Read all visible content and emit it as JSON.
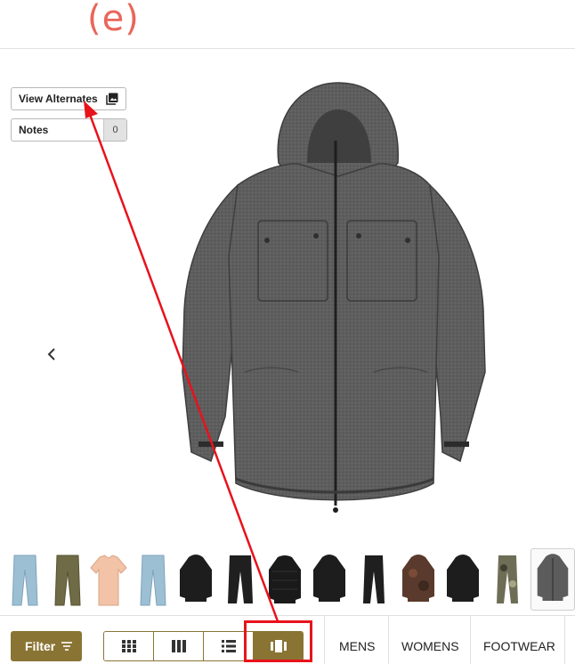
{
  "header": {
    "logo_text": "(e)",
    "logo_color": "#e9665a"
  },
  "controls": {
    "view_alternates_label": "View Alternates",
    "view_alternates_icon": "image-gallery-icon",
    "notes_label": "Notes",
    "notes_count": "0",
    "prev_icon": "chevron-left-icon"
  },
  "product": {
    "image": "charcoal-heather-hooded-snow-jacket"
  },
  "thumbnails": [
    "light-wash-jeans",
    "olive-pants",
    "peach-tshirt",
    "light-wash-jeans-2",
    "black-hooded-jacket",
    "black-snow-pants",
    "black-puffer-jacket",
    "black-hooded-jacket-2",
    "black-pants",
    "brown-camo-jacket",
    "black-jacket",
    "camo-pants",
    "charcoal-jacket-selected"
  ],
  "toolbar": {
    "filter_label": "Filter",
    "filter_icon": "sort-lines-icon",
    "views": [
      "small-grid-icon",
      "large-grid-icon",
      "list-icon",
      "single-view-icon"
    ],
    "active_view": 3,
    "nav": [
      "MENS",
      "WOMENS",
      "FOOTWEAR"
    ]
  },
  "colors": {
    "accent": "#8a7434",
    "annotation": "#e8121c",
    "jacket": "#5c5c5c"
  }
}
